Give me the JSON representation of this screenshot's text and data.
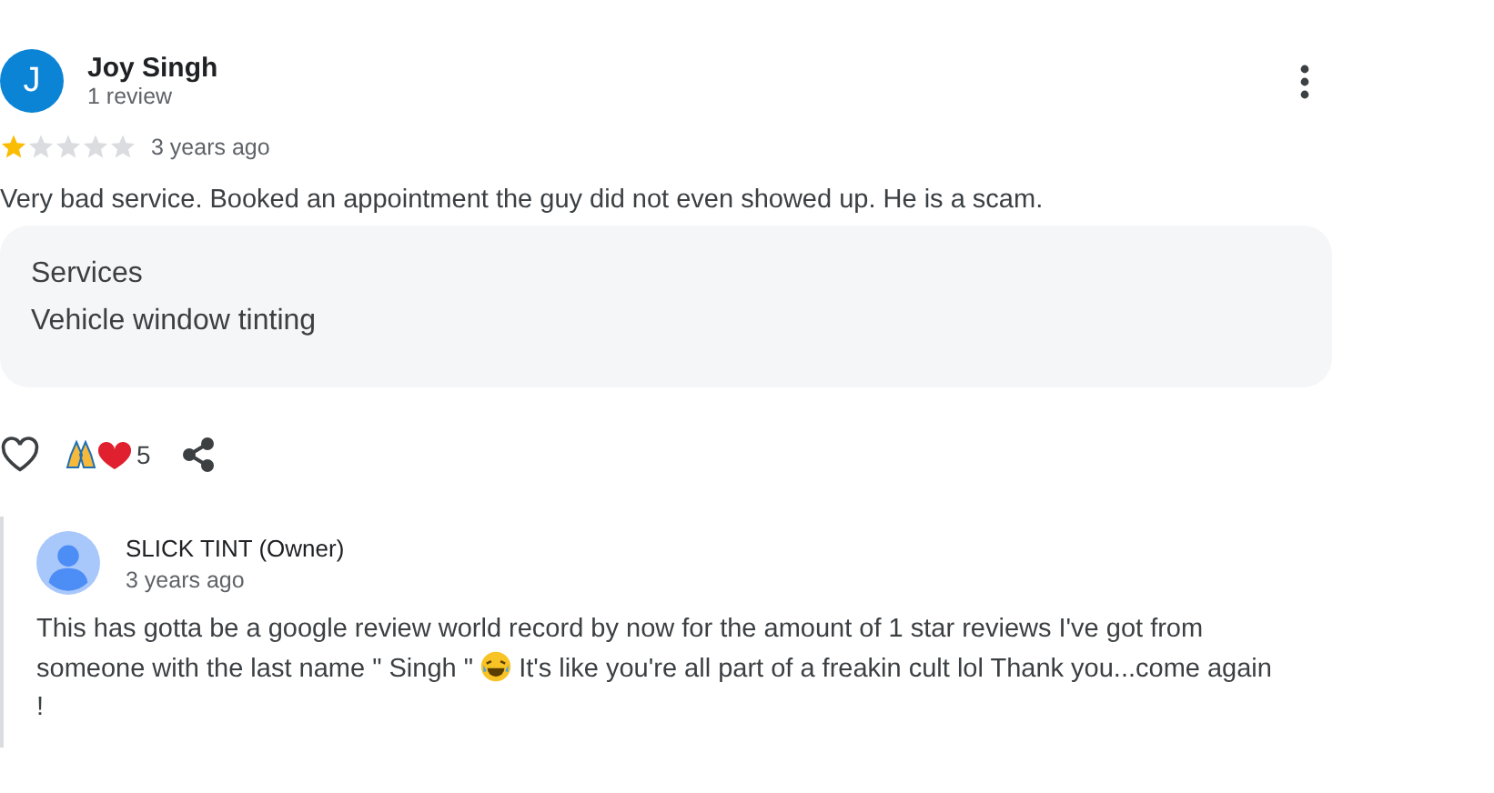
{
  "reviewer": {
    "initial": "J",
    "name": "Joy Singh",
    "count": "1 review"
  },
  "stars": 1,
  "time": "3 years ago",
  "text": "Very bad service. Booked an appointment the guy did not even showed up. He is a scam.",
  "details": {
    "label": "Services",
    "value": "Vehicle window tinting"
  },
  "reactions": {
    "liked": false,
    "count": "5"
  },
  "reply": {
    "author": "SLICK TINT (Owner)",
    "time": "3 years ago",
    "text_before": "This has gotta be a google review world record by now for the amount of 1 star reviews I've got from someone with the last name \" Singh \"",
    "text_after": "It's like you're all part of a freakin cult lol Thank you...come again !"
  }
}
